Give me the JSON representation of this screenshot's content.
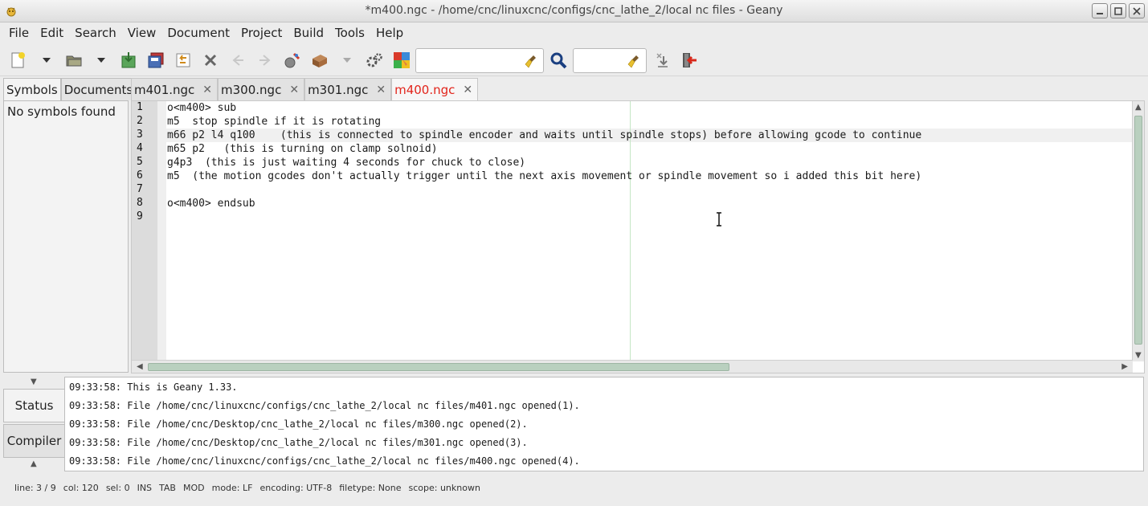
{
  "window": {
    "title": "*m400.ngc - /home/cnc/linuxcnc/configs/cnc_lathe_2/local nc files - Geany"
  },
  "menu": {
    "items": [
      "File",
      "Edit",
      "Search",
      "View",
      "Document",
      "Project",
      "Build",
      "Tools",
      "Help"
    ]
  },
  "toolbar": {
    "search_value": "",
    "goto_value": ""
  },
  "sidebar": {
    "tabs": [
      "Symbols",
      "Documents"
    ],
    "empty_text": "No symbols found"
  },
  "documents": {
    "tabs": [
      "m401.ngc",
      "m300.ngc",
      "m301.ngc",
      "m400.ngc"
    ],
    "active": 3
  },
  "editor": {
    "lines": [
      "o<m400> sub",
      "m5  stop spindle if it is rotating",
      "m66 p2 l4 q100    (this is connected to spindle encoder and waits until spindle stops) before allowing gcode to continue",
      "m65 p2   (this is turning on clamp solnoid)",
      "g4p3  (this is just waiting 4 seconds for chuck to close)",
      "m5  (the motion gcodes don't actually trigger until the next axis movement or spindle movement so i added this bit here)",
      "",
      "o<m400> endsub",
      ""
    ],
    "line_numbers": [
      "1",
      "2",
      "3",
      "4",
      "5",
      "6",
      "7",
      "8",
      "9"
    ],
    "current_line": 3
  },
  "messages": {
    "tabs": [
      "Status",
      "Compiler"
    ],
    "lines": [
      "09:33:58: This is Geany 1.33.",
      "09:33:58: File /home/cnc/linuxcnc/configs/cnc_lathe_2/local nc files/m401.ngc opened(1).",
      "09:33:58: File /home/cnc/Desktop/cnc_lathe_2/local nc files/m300.ngc opened(2).",
      "09:33:58: File /home/cnc/Desktop/cnc_lathe_2/local nc files/m301.ngc opened(3).",
      "09:33:58: File /home/cnc/linuxcnc/configs/cnc_lathe_2/local nc files/m400.ngc opened(4)."
    ]
  },
  "status": {
    "line": "line: 3 / 9",
    "col": "col: 120",
    "sel": "sel: 0",
    "ins": "INS",
    "tab": "TAB",
    "mod": "MOD",
    "mode": "mode: LF",
    "encoding": "encoding: UTF-8",
    "filetype": "filetype: None",
    "scope": "scope: unknown"
  },
  "colors": {
    "modified_tab": "#e2241b",
    "scroll_thumb": "#b9d0bf",
    "long_line_marker": "#c5e6c5"
  }
}
